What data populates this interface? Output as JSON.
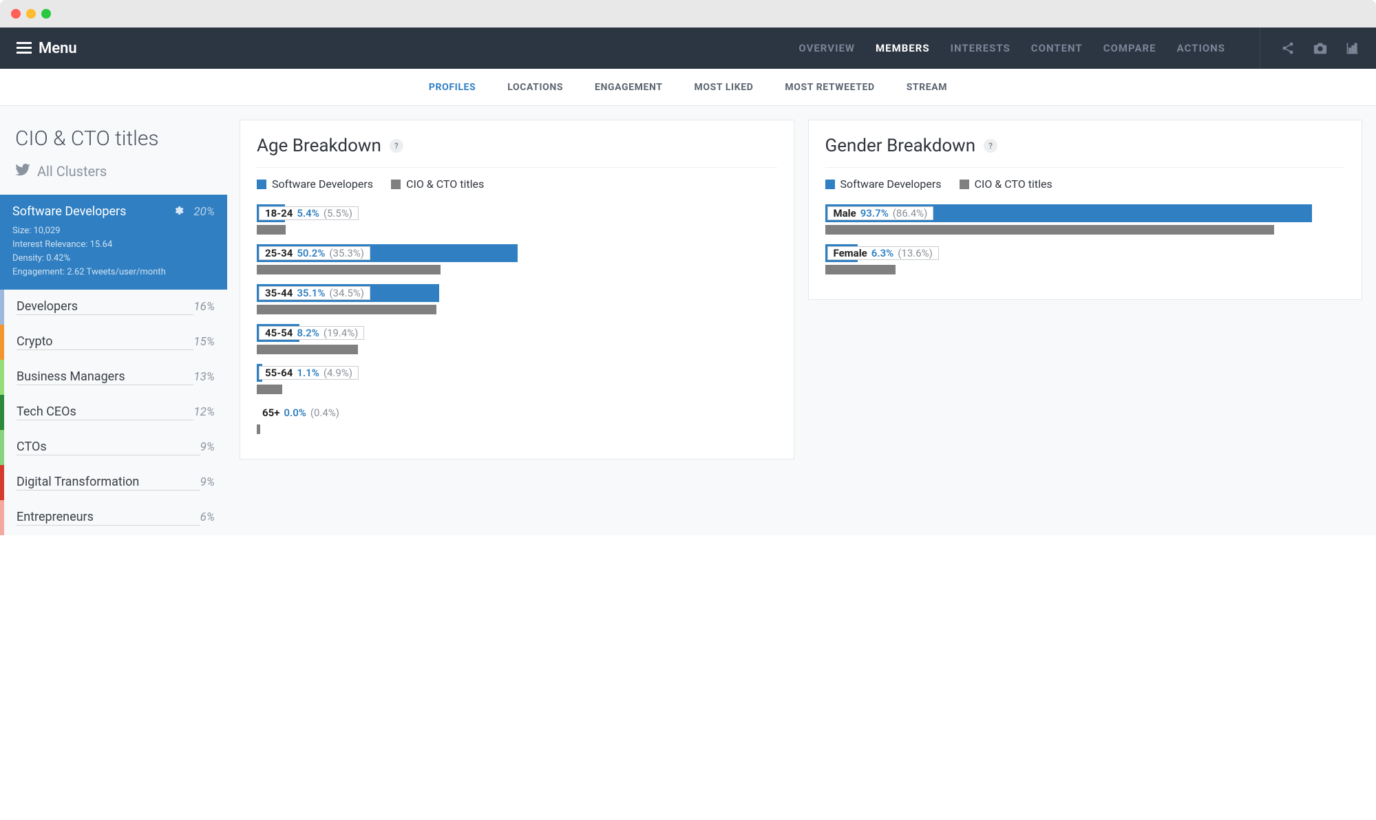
{
  "window": {
    "menu_label": "Menu"
  },
  "topnav": {
    "items": [
      {
        "label": "OVERVIEW"
      },
      {
        "label": "MEMBERS"
      },
      {
        "label": "INTERESTS"
      },
      {
        "label": "CONTENT"
      },
      {
        "label": "COMPARE"
      },
      {
        "label": "ACTIONS"
      }
    ],
    "active_index": 1
  },
  "subnav": {
    "items": [
      {
        "label": "PROFILES"
      },
      {
        "label": "LOCATIONS"
      },
      {
        "label": "ENGAGEMENT"
      },
      {
        "label": "MOST LIKED"
      },
      {
        "label": "MOST RETWEETED"
      },
      {
        "label": "STREAM"
      }
    ],
    "active_index": 0
  },
  "sidebar": {
    "title": "CIO & CTO titles",
    "subtitle": "All Clusters",
    "active_cluster": {
      "name": "Software Developers",
      "pct": "20%",
      "size_label": "Size: 10,029",
      "relevance_label": "Interest Relevance: 15.64",
      "density_label": "Density: 0.42%",
      "engagement_label": "Engagement: 2.62 Tweets/user/month"
    },
    "clusters": [
      {
        "name": "Developers",
        "pct": "16%"
      },
      {
        "name": "Crypto",
        "pct": "15%"
      },
      {
        "name": "Business Managers",
        "pct": "13%"
      },
      {
        "name": "Tech CEOs",
        "pct": "12%"
      },
      {
        "name": "CTOs",
        "pct": "9%"
      },
      {
        "name": "Digital Transformation",
        "pct": "9%"
      },
      {
        "name": "Entrepreneurs",
        "pct": "6%"
      }
    ]
  },
  "age_card": {
    "title": "Age Breakdown",
    "legend": {
      "series1": "Software Developers",
      "series2": "CIO & CTO titles"
    }
  },
  "gender_card": {
    "title": "Gender Breakdown",
    "legend": {
      "series1": "Software Developers",
      "series2": "CIO & CTO titles"
    }
  },
  "chart_data": [
    {
      "type": "bar",
      "title": "Age Breakdown",
      "categories": [
        "18-24",
        "25-34",
        "35-44",
        "45-54",
        "55-64",
        "65+"
      ],
      "series": [
        {
          "name": "Software Developers",
          "values": [
            5.4,
            50.2,
            35.1,
            8.2,
            1.1,
            0.0
          ],
          "color": "#2f7fc2"
        },
        {
          "name": "CIO & CTO titles",
          "values": [
            5.5,
            35.3,
            34.5,
            19.4,
            4.9,
            0.4
          ],
          "color": "#808080"
        }
      ],
      "xlim": [
        0,
        100
      ],
      "unit": "%"
    },
    {
      "type": "bar",
      "title": "Gender Breakdown",
      "categories": [
        "Male",
        "Female"
      ],
      "series": [
        {
          "name": "Software Developers",
          "values": [
            93.7,
            6.3
          ],
          "color": "#2f7fc2"
        },
        {
          "name": "CIO & CTO titles",
          "values": [
            86.4,
            13.6
          ],
          "color": "#808080"
        }
      ],
      "xlim": [
        0,
        100
      ],
      "unit": "%"
    }
  ]
}
